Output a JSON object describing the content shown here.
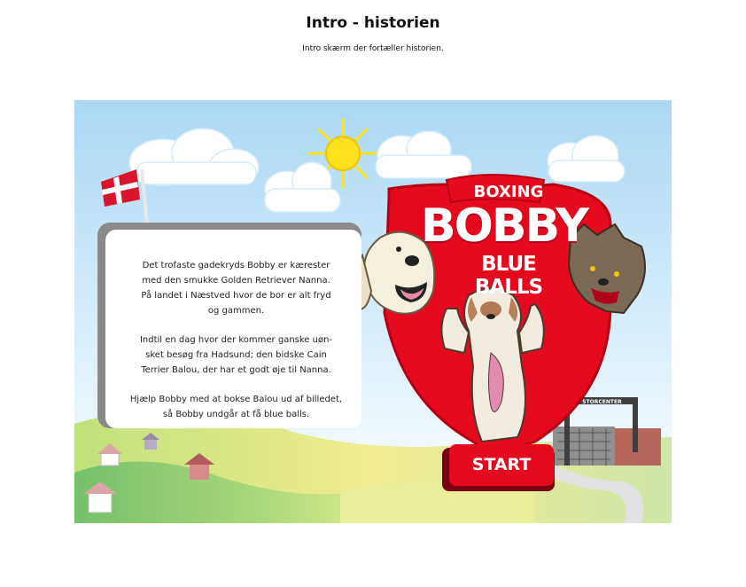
{
  "page": {
    "title": "Intro - historien",
    "subtitle": "Intro skærm der fortæller historien."
  },
  "game": {
    "logo": {
      "line1": "BOXING",
      "line2": "BOBBY",
      "line3": "BLUE BALLS"
    },
    "story": {
      "paragraph1": "Det trofaste gadekryds Bobby er kærester\nmed den smukke Golden Retriever Nanna.\nPå landet i Næstved hvor de bor er alt fryd\nog gammen.",
      "paragraph2": "Indtil en dag hvor der kommer ganske uøn-\nsket besøg fra Hadsund; den bidske Cain\nTerrier Balou, der har et godt øje til Nanna.",
      "paragraph3": "Hjælp Bobby med at bokse Balou ud af billedet,\nså Bobby undgår at få blue balls."
    },
    "storcenter_sign": "STORCENTER",
    "start_button": "START"
  },
  "colors": {
    "sky_top": "#a9d8f5",
    "grass": "#8fcf6d",
    "field_yellow": "#f0ea8a",
    "logo_red": "#e4091d",
    "sun": "#ffe21a",
    "flag_red": "#d9142b",
    "story_back": "#8a8a8a"
  },
  "icons": [
    "sun-icon",
    "danish-flag-icon",
    "cloud-icon",
    "house-icon",
    "storcenter-building-icon"
  ]
}
